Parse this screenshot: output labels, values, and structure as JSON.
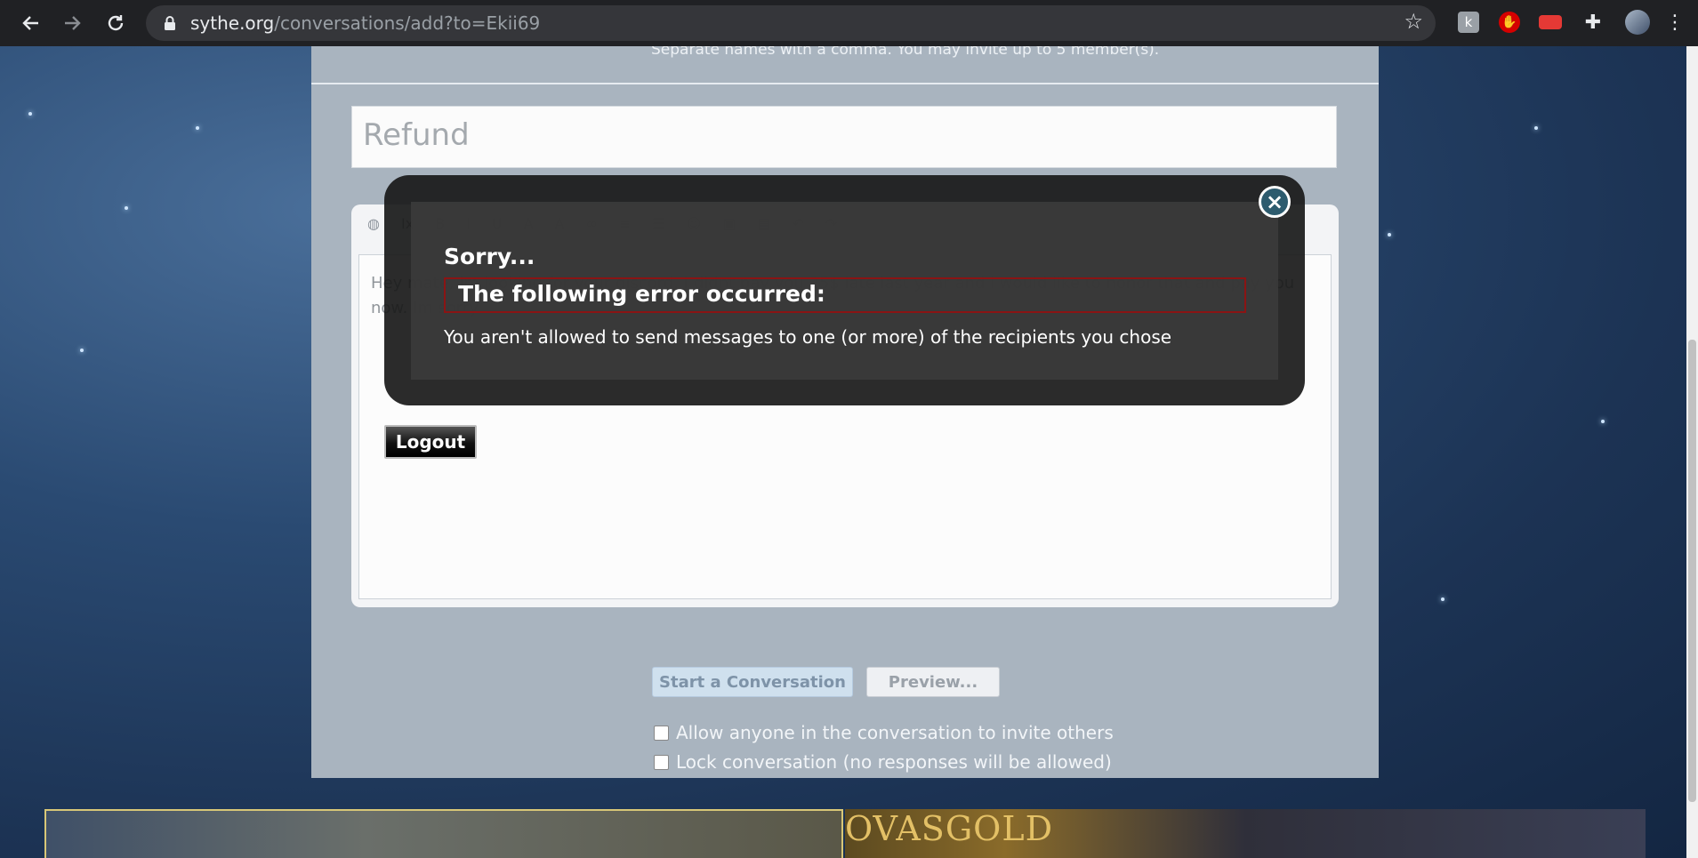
{
  "browser": {
    "url_host": "sythe.org",
    "url_path": "/conversations/add?to=Ekii69"
  },
  "form": {
    "invite_hint": "Separate names with a comma. You may invite up to 5 member(s).",
    "title_value": "Refund",
    "message_text": "Hey mate, im looking for your discord. I didnt pay you 25$ late last year and i would like to honor that and pay you now. Im sorry.",
    "start_button": "Start a Conversation",
    "preview_button": "Preview...",
    "option_invite": "Allow anyone in the conversation to invite others",
    "option_lock": "Lock conversation (no responses will be allowed)"
  },
  "banner": {
    "brand": "OVASGOLD"
  },
  "modal": {
    "title": "Sorry...",
    "heading": "The following error occurred:",
    "message": "You aren't allowed to send messages to one (or more) of the recipients you chose",
    "close_glyph": "×"
  },
  "logout_button": "Logout",
  "colors": {
    "modal_bg": "#191919",
    "error_border": "#8a1414",
    "start_button_bg": "#cfe0ee"
  },
  "icons": {
    "back": "back-arrow-icon",
    "forward": "forward-arrow-icon",
    "reload": "reload-icon",
    "lock": "lock-icon",
    "bookmark": "star-icon",
    "extensions": "puzzle-icon",
    "menu": "kebab-menu-icon"
  }
}
